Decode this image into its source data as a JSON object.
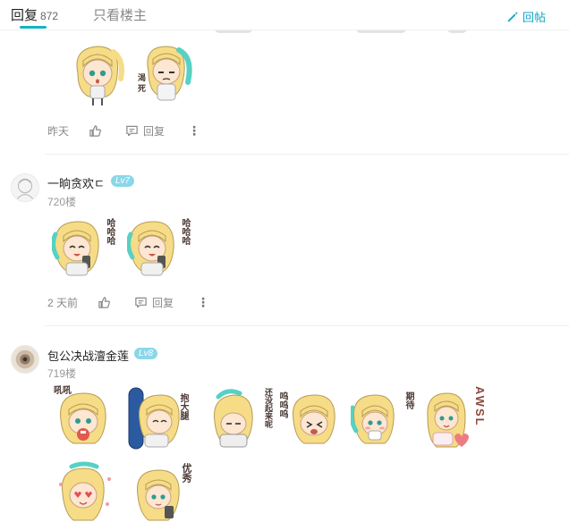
{
  "tabs": {
    "reply_label": "回复",
    "reply_count": "872",
    "only_op_label": "只看楼主"
  },
  "reply_button": {
    "label": "回帖"
  },
  "colors": {
    "accent": "#14b3c4",
    "level_badge": "#8ad7e9",
    "hair": "#f6dc86",
    "hair_tip": "#56d1c3"
  },
  "posts": [
    {
      "time": "昨天",
      "reply_label": "回复",
      "more": "⋮",
      "stickers": [
        "sticker-surprised",
        "sticker-speechless"
      ]
    },
    {
      "username": "一晌贪欢ㄷ",
      "level": "Lv7",
      "floor": "720楼",
      "time": "2 天前",
      "reply_label": "回复",
      "more": "⋮",
      "stickers": [
        "sticker-phone-laugh",
        "sticker-phone-laugh"
      ],
      "doodles": [
        "哈哈哈",
        "哈哈哈"
      ]
    },
    {
      "username": "包公决战澶金莲",
      "level": "Lv8",
      "floor": "719楼",
      "stickers": [
        "sticker-eating",
        "sticker-hug-pillow",
        "sticker-mumble",
        "sticker-sob",
        "sticker-shy",
        "sticker-awsl",
        "sticker-heart-eyes",
        "sticker-excellent"
      ],
      "doodles": [
        "吼吼",
        "抱大腿",
        "还没起来呢",
        "呜呜呜",
        "期待",
        "AWSL",
        "优秀"
      ]
    }
  ]
}
